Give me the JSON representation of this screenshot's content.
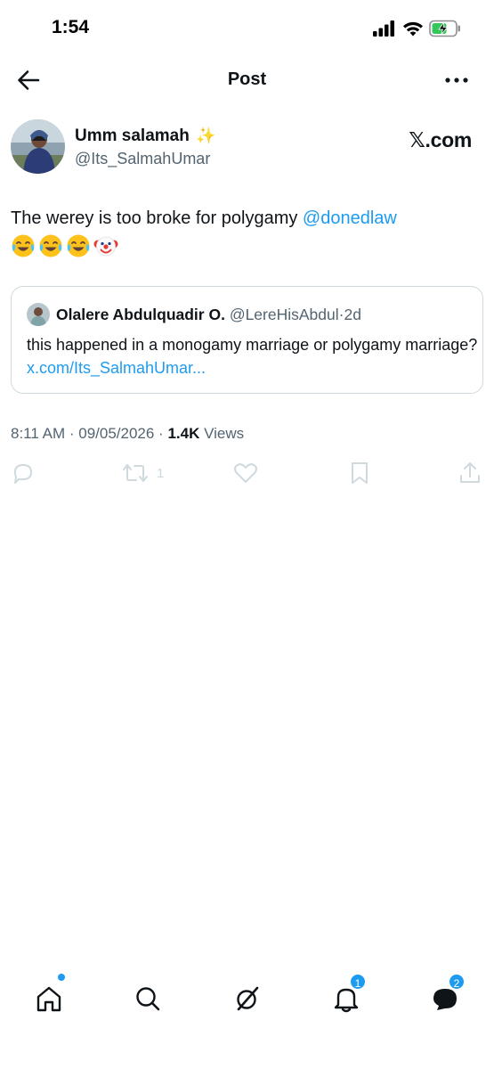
{
  "status_bar": {
    "time": "1:54"
  },
  "header": {
    "title": "Post"
  },
  "post": {
    "author_name": "Umm salamah",
    "author_badge": "✨",
    "author_handle": "@Its_SalmahUmar",
    "source_label": "𝕏.com",
    "text": "The werey is too broke for polygamy ",
    "mention": "@donedlaw",
    "emojis": [
      "face-with-tears-of-joy",
      "face-with-tears-of-joy",
      "face-with-tears-of-joy",
      "clown-face"
    ]
  },
  "quoted_post": {
    "author_name": "Olalere Abdulquadir O.",
    "author_handle": "@LereHisAbdul",
    "separator": "·",
    "age": "2d",
    "text": "this happened in a monogamy marriage or polygamy marriage? ",
    "link": "x.com/Its_SalmahUmar..."
  },
  "meta": {
    "time": "8:11 AM",
    "date": "09/05/2026",
    "views_count": "1.4K",
    "views_label": " Views",
    "separator": " · "
  },
  "actions": {
    "reply_icon": "reply-icon",
    "repost_icon": "repost-icon",
    "repost_count": "1",
    "like_icon": "heart-icon",
    "bookmark_icon": "bookmark-icon",
    "share_icon": "share-icon"
  },
  "bottom_nav": {
    "items": [
      "home-icon",
      "search-icon",
      "grok-icon",
      "notifications-icon",
      "messages-icon"
    ],
    "notifications_badge": "1",
    "messages_badge": "2"
  },
  "colors": {
    "accent": "#1d9bf0",
    "text": "#0f1419",
    "muted": "#536471",
    "border": "#cfd9de"
  }
}
